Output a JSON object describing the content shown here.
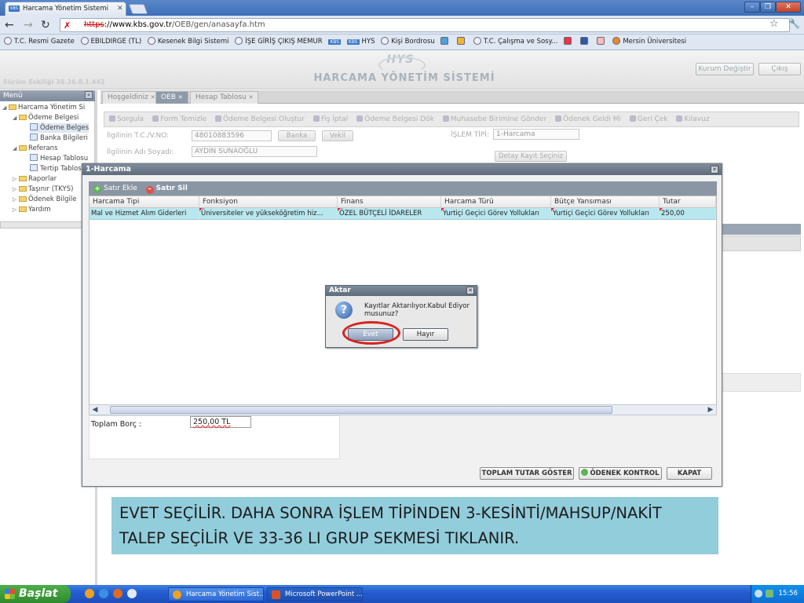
{
  "browser": {
    "tab_title": "Harcama Yönetim Sistemi",
    "tab_favicon": "KBS",
    "url_https": "https",
    "url_host": "://www.kbs.gov.tr",
    "url_path": "/OEB/gen/anasayfa.htm"
  },
  "bookmarks": [
    "T.C. Resmi Gazete",
    "EBILDIRGE (TL)",
    "Kesenek Bilgi Sistemi",
    "İŞE GİRİŞ ÇIKIŞ MEMUR",
    "HYS",
    "Kişi Bordrosu",
    "T.C. Çalışma ve Sosy...",
    "Mersin Üniversitesi"
  ],
  "bookmark_badges": [
    "KBS",
    "KBS"
  ],
  "app": {
    "logo": "HYS",
    "title": "HARCAMA YÖNETİM SİSTEMİ",
    "version": "Sürüm Eskiliği 38.36.8.1.442",
    "btn_kurum": "Kurum Değiştir",
    "btn_cikis": "Çıkış"
  },
  "menu": {
    "header": "Menü",
    "items": [
      "Harcama Yönetim Si",
      "Ödeme Belgesi",
      "Ödeme Belges",
      "Banka Bilgileri",
      "Referans",
      "Hesap Tablosu",
      "Tertip Tablos",
      "Raporlar",
      "Taşınır (TKYS)",
      "Ödenek Bilgile",
      "Yardım"
    ]
  },
  "tabs": [
    "Hoşgeldiniz",
    "OEB",
    "Hesap Tablosu"
  ],
  "actions": [
    "Sorgula",
    "Form Temizle",
    "Ödeme Belgesi Oluştur",
    "Fiş İptal",
    "Ödeme Belgesi Dök",
    "Muhasebe Birimine Gönder",
    "Ödenek Geldi Mi",
    "Geri Çek",
    "Kılavuz"
  ],
  "form": {
    "tc_label": "İlgilinin T.C./V.NO:",
    "tc_value": "48010883596",
    "banka_btn": "Banka",
    "vekil_btn": "Vekil",
    "ad_label": "İlgilinin Adı Soyadı:",
    "ad_value": "AYDIN SUNAOĞLU",
    "islem_label": "İŞLEM TİPİ:",
    "islem_value": "1-Harcama",
    "detay_btn": "Detay Kayıt Seçiniz"
  },
  "window": {
    "title": "1-Harcama",
    "add_row": "Satır Ekle",
    "del_row": "Satır Sil",
    "columns": [
      "Harcama Tipi",
      "Fonksiyon",
      "Finans",
      "Harcama Türü",
      "Bütçe Yansıması",
      "Tutar"
    ],
    "row": [
      "Mal ve Hizmet Alım Giderleri",
      "Üniversiteler ve yükseköğretim hiz...",
      "ÖZEL BÜTÇELİ İDARELER",
      "Yurtiçi Geçici Görev Yollukları",
      "Yurtiçi Geçici Görev Yollukları",
      "250,00"
    ],
    "total_label": "Toplam Borç :",
    "total_value": "250,00 TL",
    "btn_toplam": "TOPLAM TUTAR GÖSTER",
    "btn_odenek": "ÖDENEK KONTROL",
    "btn_kapat": "KAPAT"
  },
  "dialog": {
    "title": "Aktar",
    "message": "Kayıtlar Aktarılıyor.Kabul Ediyor musunuz?",
    "yes": "Evet",
    "no": "Hayır"
  },
  "caption": "EVET SEÇİLİR. DAHA SONRA İŞLEM TİPİNDEN 3-KESİNTİ/MAHSUP/NAKİT TALEP SEÇİLİR VE 33-36 LI GRUP SEKMESİ TIKLANIR.",
  "taskbar": {
    "start": "Başlat",
    "items": [
      "Harcama Yönetim Sist...",
      "Microsoft PowerPoint ..."
    ],
    "time": "15:56"
  },
  "colors": {
    "caption_bg": "#92cddc",
    "highlight_circle": "#d8231e",
    "row_selected": "#b9e7ef"
  }
}
